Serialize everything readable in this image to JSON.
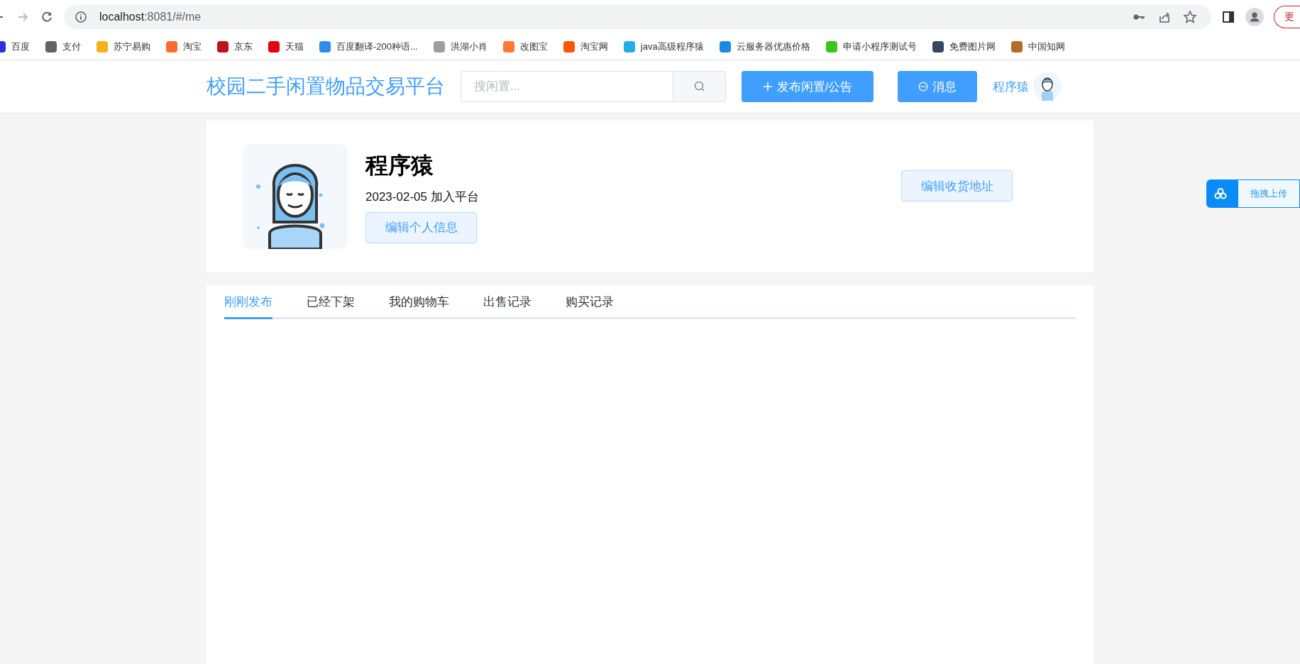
{
  "browser": {
    "url_host": "localhost",
    "url_rest": ":8081/#/me",
    "update_button": "更"
  },
  "bookmarks": [
    {
      "label": "百度",
      "color": "#2932e1"
    },
    {
      "label": "支付",
      "color": "#5f6368"
    },
    {
      "label": "苏宁易购",
      "color": "#f5b21b"
    },
    {
      "label": "淘宝",
      "color": "#ff6a2b"
    },
    {
      "label": "京东",
      "color": "#c3111c"
    },
    {
      "label": "天猫",
      "color": "#e60012"
    },
    {
      "label": "百度翻译-200种语...",
      "color": "#2b8cf0"
    },
    {
      "label": "洪湖小肖",
      "color": "#9e9e9e"
    },
    {
      "label": "改图宝",
      "color": "#ff7a2f"
    },
    {
      "label": "淘宝网",
      "color": "#ff5500"
    },
    {
      "label": "java高级程序猿",
      "color": "#23ade5"
    },
    {
      "label": "云服务器优惠价格",
      "color": "#1e88e5"
    },
    {
      "label": "申请小程序测试号",
      "color": "#3cc51f"
    },
    {
      "label": "免费图片网",
      "color": "#34495e"
    },
    {
      "label": "中国知网",
      "color": "#b36b2c"
    }
  ],
  "header": {
    "title": "校园二手闲置物品交易平台",
    "search": {
      "placeholder": "搜闲置..."
    },
    "publish_button": "发布闲置/公告",
    "message_button": "消息",
    "user_name": "程序猿"
  },
  "profile": {
    "name": "程序猿",
    "joined": "2023-02-05 加入平台",
    "edit_info_button": "编辑个人信息",
    "edit_address_button": "编辑收货地址"
  },
  "tabs": [
    {
      "label": "刚刚发布",
      "selected": true
    },
    {
      "label": "已经下架",
      "selected": false
    },
    {
      "label": "我的购物车",
      "selected": false
    },
    {
      "label": "出售记录",
      "selected": false
    },
    {
      "label": "购买记录",
      "selected": false
    }
  ],
  "upload_widget": {
    "label": "拖拽上传"
  }
}
